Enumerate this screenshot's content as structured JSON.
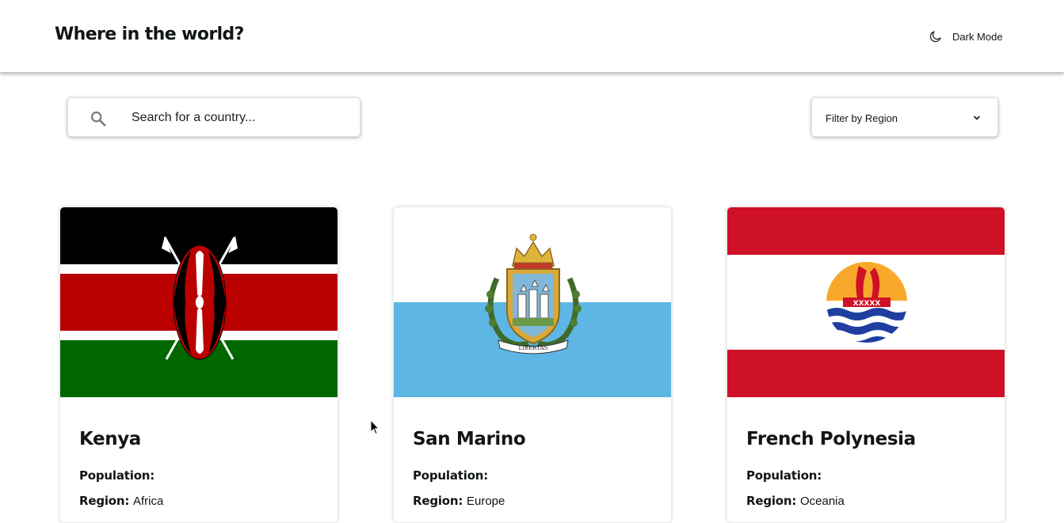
{
  "header": {
    "title": "Where in the world?",
    "dark_mode_label": "Dark Mode",
    "dark_mode_icon": "moon-icon"
  },
  "search": {
    "placeholder": "Search for a country...",
    "value": "",
    "icon": "search-icon"
  },
  "filter": {
    "label": "Filter by Region",
    "icon": "chevron-down-icon"
  },
  "countries": [
    {
      "name": "Kenya",
      "population_label": "Population",
      "population": "",
      "region_label": "Region",
      "region": "Africa",
      "flag": "kenya-flag"
    },
    {
      "name": "San Marino",
      "population_label": "Population",
      "population": "",
      "region_label": "Region",
      "region": "Europe",
      "flag": "san-marino-flag"
    },
    {
      "name": "French Polynesia",
      "population_label": "Population",
      "population": "",
      "region_label": "Region",
      "region": "Oceania",
      "flag": "french-polynesia-flag"
    }
  ],
  "colors": {
    "text": "#111517",
    "background": "#ffffff",
    "kenya_red": "#bb0000",
    "kenya_green": "#006600",
    "san_marino_blue": "#5eb6e4",
    "polynesia_red": "#ce1126"
  }
}
